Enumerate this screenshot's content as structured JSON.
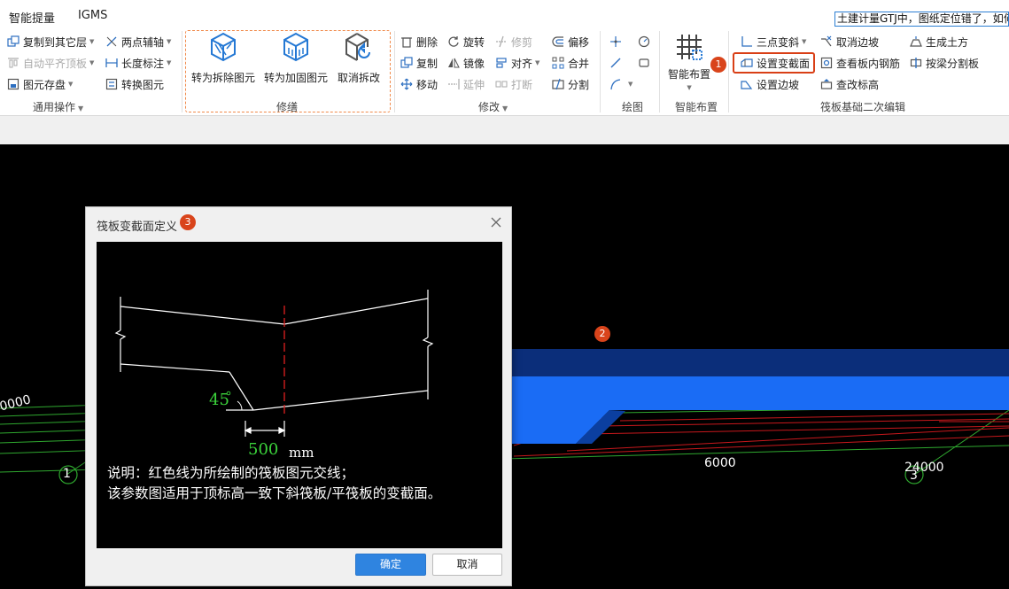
{
  "menu": {
    "items": [
      "智能提量",
      "IGMS"
    ],
    "tip": "土建计量GTJ中，图纸定位错了，如何"
  },
  "ribbon": {
    "general": {
      "label": "通用操作",
      "buttons": [
        "复制到其它层",
        "自动平齐顶板",
        "图元存盘",
        "两点辅轴",
        "长度标注",
        "转换图元"
      ]
    },
    "xiuxiu": {
      "label": "修缮",
      "buttons": [
        "转为拆除图元",
        "转为加固图元",
        "取消拆改"
      ]
    },
    "modify": {
      "label": "修改",
      "buttons": [
        "删除",
        "旋转",
        "修剪",
        "偏移",
        "复制",
        "镜像",
        "对齐",
        "合并",
        "移动",
        "延伸",
        "打断",
        "分割"
      ]
    },
    "draw": {
      "label": "绘图"
    },
    "smart": {
      "label": "智能布置",
      "button": "智能布置"
    },
    "raft": {
      "label": "筏板基础二次编辑",
      "buttons": [
        "三点变斜",
        "取消边坡",
        "生成土方",
        "设置变截面",
        "查看板内钢筋",
        "按梁分割板",
        "设置边坡",
        "查改标高"
      ]
    }
  },
  "badges": [
    "1",
    "2",
    "3"
  ],
  "canvas": {
    "axis_labels": [
      "0000",
      "6000",
      "24000"
    ],
    "axis_circles": [
      "1",
      "3"
    ]
  },
  "dialog": {
    "title": "筏板变截面定义",
    "angle": "45",
    "dimension": "500",
    "unit": "mm",
    "note_line1": "说明：红色线为所绘制的筏板图元交线；",
    "note_line2": "该参数图适用于顶标高一致下斜筏板/平筏板的变截面。",
    "ok_label": "确定",
    "cancel_label": "取消"
  },
  "colors": {
    "accent": "#2f84e0",
    "highlight": "#d93f16",
    "badge": "#d9441b",
    "dash_frame": "#f08a4b",
    "slab_blue": "#1a6cf5",
    "slab_dark": "#0b2e7a",
    "grid_green": "#2fa82f",
    "grid_red": "#c8181c"
  }
}
